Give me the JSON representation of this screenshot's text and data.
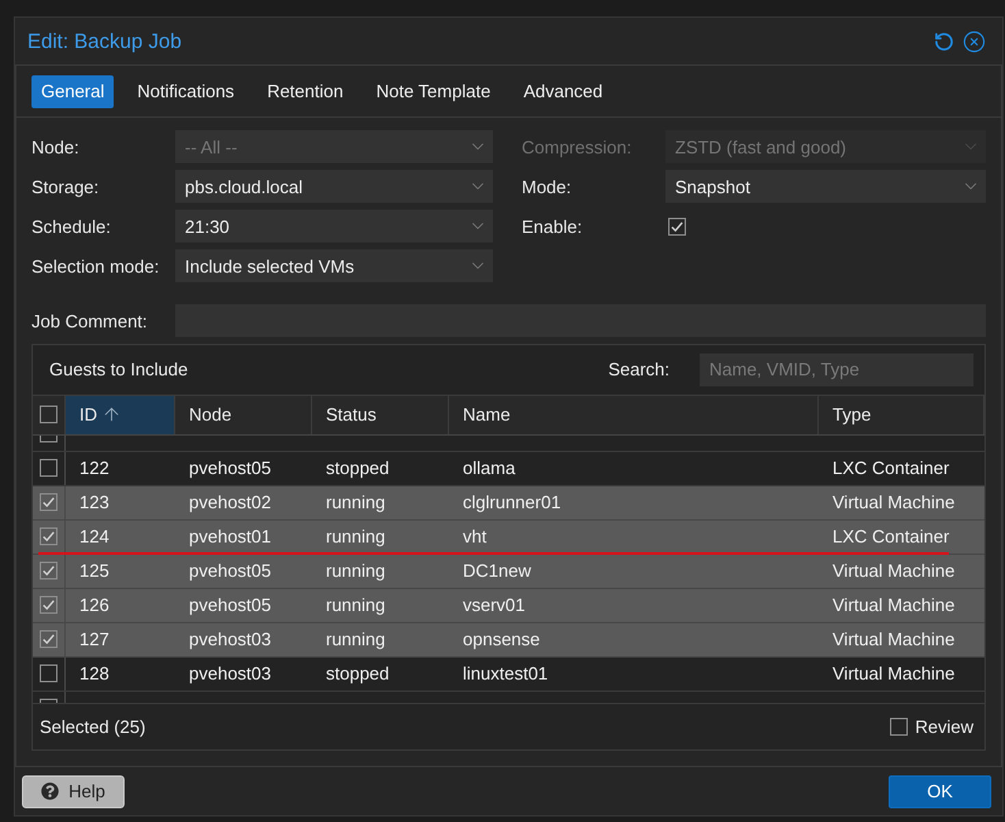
{
  "dialog": {
    "title": "Edit: Backup Job"
  },
  "tabs": [
    {
      "label": "General",
      "selected": true
    },
    {
      "label": "Notifications",
      "selected": false
    },
    {
      "label": "Retention",
      "selected": false
    },
    {
      "label": "Note Template",
      "selected": false
    },
    {
      "label": "Advanced",
      "selected": false
    }
  ],
  "form": {
    "left": [
      {
        "kind": "select",
        "label": "Node:",
        "placeholder": "-- All --",
        "disabled": false
      },
      {
        "kind": "select",
        "label": "Storage:",
        "value": "pbs.cloud.local",
        "disabled": false
      },
      {
        "kind": "select",
        "label": "Schedule:",
        "value": "21:30",
        "disabled": false
      },
      {
        "kind": "select",
        "label": "Selection mode:",
        "value": "Include selected VMs",
        "disabled": false
      }
    ],
    "right": [
      {
        "kind": "select",
        "label": "Compression:",
        "value": "ZSTD (fast and good)",
        "disabled": true
      },
      {
        "kind": "select",
        "label": "Mode:",
        "value": "Snapshot",
        "disabled": false
      },
      {
        "kind": "checkbox",
        "label": "Enable:",
        "checked": true,
        "disabled": false
      }
    ],
    "comment": {
      "label": "Job Comment:"
    }
  },
  "guests": {
    "title": "Guests to Include",
    "search": {
      "label": "Search:",
      "placeholder": "Name, VMID, Type"
    },
    "select_all": {
      "checked": false
    },
    "columns": [
      {
        "label": "ID",
        "sorted": true
      },
      {
        "label": "Node",
        "sorted": false
      },
      {
        "label": "Status",
        "sorted": false
      },
      {
        "label": "Name",
        "sorted": false
      },
      {
        "label": "Type",
        "sorted": false
      }
    ],
    "rows": [
      {
        "checked": false,
        "underlined": false
      },
      {
        "id": "122",
        "node": "pvehost05",
        "status": "stopped",
        "name": "ollama",
        "type": "LXC Container",
        "checked": false,
        "underlined": false
      },
      {
        "id": "123",
        "node": "pvehost02",
        "status": "running",
        "name": "clglrunner01",
        "type": "Virtual Machine",
        "checked": true,
        "underlined": false
      },
      {
        "id": "124",
        "node": "pvehost01",
        "status": "running",
        "name": "vht",
        "type": "LXC Container",
        "checked": true,
        "underlined": true
      },
      {
        "id": "125",
        "node": "pvehost05",
        "status": "running",
        "name": "DC1new",
        "type": "Virtual Machine",
        "checked": true,
        "underlined": false
      },
      {
        "id": "126",
        "node": "pvehost05",
        "status": "running",
        "name": "vserv01",
        "type": "Virtual Machine",
        "checked": true,
        "underlined": false
      },
      {
        "id": "127",
        "node": "pvehost03",
        "status": "running",
        "name": "opnsense",
        "type": "Virtual Machine",
        "checked": true,
        "underlined": false
      },
      {
        "id": "128",
        "node": "pvehost03",
        "status": "stopped",
        "name": "linuxtest01",
        "type": "Virtual Machine",
        "checked": false,
        "underlined": false
      },
      {
        "checked": false,
        "underlined": false
      }
    ],
    "selected_count": "Selected (25)",
    "review": {
      "label": "Review",
      "checked": false
    }
  },
  "buttons": {
    "help": "Help",
    "ok": "OK"
  }
}
